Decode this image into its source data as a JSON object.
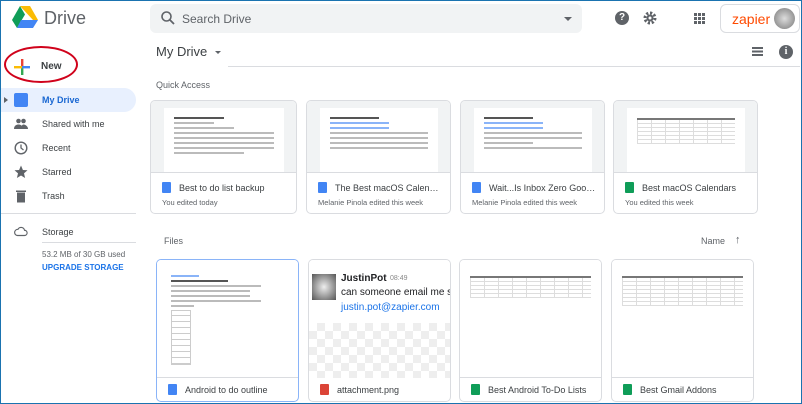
{
  "app": {
    "title": "Drive",
    "search_placeholder": "Search Drive",
    "account_brand": "zapier"
  },
  "sidebar": {
    "new_label": "New",
    "items": [
      {
        "label": "My Drive"
      },
      {
        "label": "Shared with me"
      },
      {
        "label": "Recent"
      },
      {
        "label": "Starred"
      },
      {
        "label": "Trash"
      }
    ],
    "storage": {
      "label": "Storage",
      "used": "53.2 MB of 30 GB used",
      "upgrade": "UPGRADE STORAGE"
    }
  },
  "main": {
    "title": "My Drive",
    "quick_access_label": "Quick Access",
    "files_label": "Files",
    "sort_label": "Name",
    "quick_access": [
      {
        "name": "Best to do list backup",
        "sub": "You edited today",
        "type": "doc"
      },
      {
        "name": "The Best macOS Calendar A...",
        "sub": "Melanie Pinola edited this week",
        "type": "doc"
      },
      {
        "name": "Wait...Is Inbox Zero Good or ...",
        "sub": "Melanie Pinola edited this week",
        "type": "doc"
      },
      {
        "name": "Best macOS Calendars",
        "sub": "You edited this week",
        "type": "sheet"
      }
    ],
    "files": [
      {
        "name": "Android to do outline",
        "type": "doc"
      },
      {
        "name": "attachment.png",
        "type": "image"
      },
      {
        "name": "Best Android To-Do Lists",
        "type": "sheet"
      },
      {
        "name": "Best Gmail Addons",
        "type": "sheet"
      }
    ],
    "attachment_preview": {
      "user": "JustinPot",
      "time": "08:49",
      "message": "can someone email me sor",
      "email": "justin.pot@zapier.com"
    }
  },
  "colors": {
    "accent": "#1967d2",
    "active_bg": "#e8f0fe",
    "annotation": "#d0021b"
  }
}
